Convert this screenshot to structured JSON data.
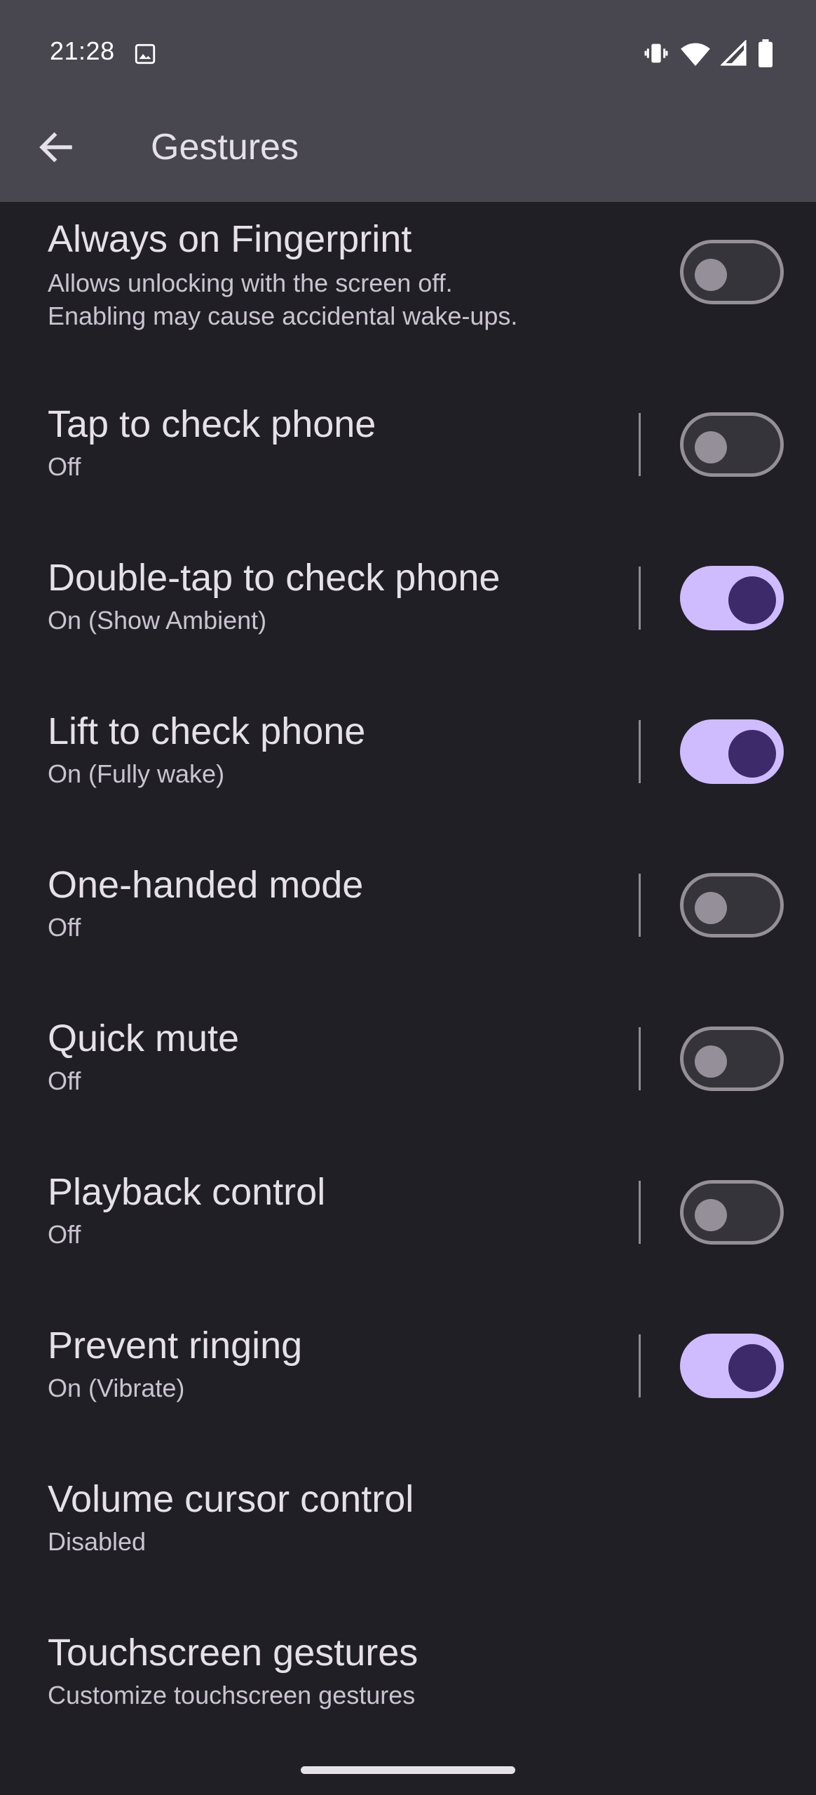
{
  "status_bar": {
    "time": "21:28",
    "icons": [
      "gallery-icon",
      "vibrate-icon",
      "wifi-icon",
      "signal-icon",
      "battery-icon"
    ]
  },
  "app_bar": {
    "title": "Gestures",
    "back_icon": "arrow-back-icon"
  },
  "settings": [
    {
      "title": "Always on Fingerprint",
      "subtitle_line1": "Allows unlocking with the screen off.",
      "subtitle_line2": "Enabling may cause accidental wake-ups.",
      "toggle": false,
      "divider": false
    },
    {
      "title": "Tap to check phone",
      "subtitle": "Off",
      "toggle": false,
      "divider": true
    },
    {
      "title": "Double-tap to check phone",
      "subtitle": "On (Show Ambient)",
      "toggle": true,
      "divider": true
    },
    {
      "title": "Lift to check phone",
      "subtitle": "On (Fully wake)",
      "toggle": true,
      "divider": true
    },
    {
      "title": "One-handed mode",
      "subtitle": "Off",
      "toggle": false,
      "divider": true
    },
    {
      "title": "Quick mute",
      "subtitle": "Off",
      "toggle": false,
      "divider": true
    },
    {
      "title": "Playback control",
      "subtitle": "Off",
      "toggle": false,
      "divider": true
    },
    {
      "title": "Prevent ringing",
      "subtitle": "On (Vibrate)",
      "toggle": true,
      "divider": true
    },
    {
      "title": "Volume cursor control",
      "subtitle": "Disabled"
    },
    {
      "title": "Touchscreen gestures",
      "subtitle": "Customize touchscreen gestures"
    }
  ],
  "colors": {
    "background": "#211f26",
    "app_bar": "#48464f",
    "switch_on_track": "#cfbcff",
    "switch_on_thumb": "#3c2a6b",
    "switch_off_outline": "#948f99"
  }
}
